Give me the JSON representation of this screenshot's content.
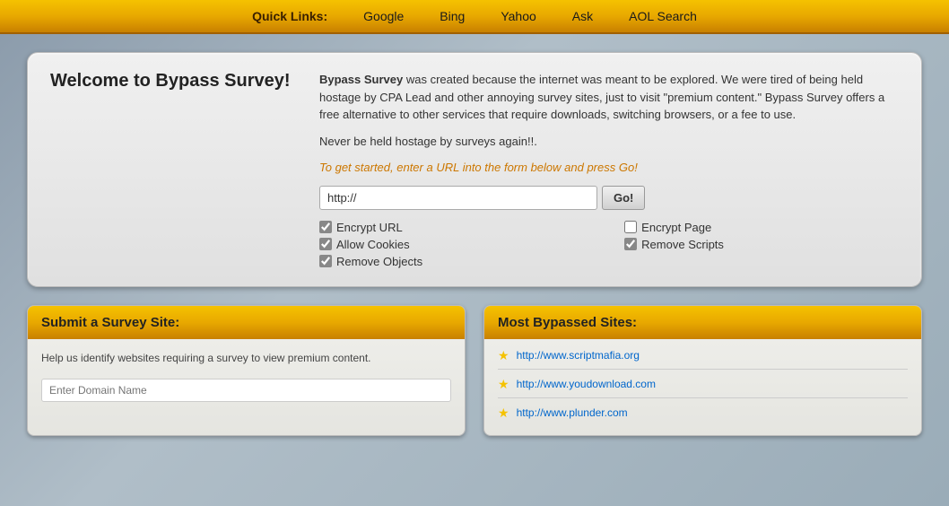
{
  "nav": {
    "label": "Quick Links:",
    "links": [
      {
        "id": "google",
        "label": "Google",
        "url": "https://www.google.com"
      },
      {
        "id": "bing",
        "label": "Bing",
        "url": "https://www.bing.com"
      },
      {
        "id": "yahoo",
        "label": "Yahoo",
        "url": "https://www.yahoo.com"
      },
      {
        "id": "ask",
        "label": "Ask",
        "url": "https://www.ask.com"
      },
      {
        "id": "aol",
        "label": "AOL Search",
        "url": "https://search.aol.com"
      }
    ]
  },
  "welcome": {
    "title": "Welcome to Bypass Survey!",
    "body_bold": "Bypass Survey",
    "body_text": " was created because the internet was meant to be explored. We were tired of being held hostage by CPA Lead and other annoying survey sites, just to visit \"premium content.\" Bypass Survey offers a free alternative to other services that require downloads, switching browsers, or a fee to use.",
    "tagline": "Never be held hostage by surveys again!!.",
    "cta": "To get started, enter a URL into the form below and press Go!",
    "url_placeholder": "http://",
    "go_label": "Go!"
  },
  "checkboxes": [
    {
      "id": "encrypt-url",
      "label": "Encrypt URL",
      "checked": true,
      "col": 1
    },
    {
      "id": "encrypt-page",
      "label": "Encrypt Page",
      "checked": false,
      "col": 2
    },
    {
      "id": "allow-cookies",
      "label": "Allow Cookies",
      "checked": true,
      "col": 1
    },
    {
      "id": "remove-scripts",
      "label": "Remove Scripts",
      "checked": true,
      "col": 2
    },
    {
      "id": "remove-objects",
      "label": "Remove Objects",
      "checked": true,
      "col": 1
    }
  ],
  "survey_card": {
    "header": "Submit a Survey Site:",
    "description": "Help us identify websites requiring a survey to view premium content.",
    "input_placeholder": "Enter Domain Name"
  },
  "bypassed_card": {
    "header": "Most Bypassed Sites:",
    "sites": [
      {
        "url": "http://www.scriptmafia.org",
        "label": "http://www.scriptmafia.org"
      },
      {
        "url": "http://www.youdownload.com",
        "label": "http://www.youdownload.com"
      },
      {
        "url": "http://www.plunder.com",
        "label": "http://www.plunder.com"
      }
    ]
  },
  "colors": {
    "gold": "#f5c200",
    "gold_dark": "#c88000",
    "link": "#0066cc"
  }
}
